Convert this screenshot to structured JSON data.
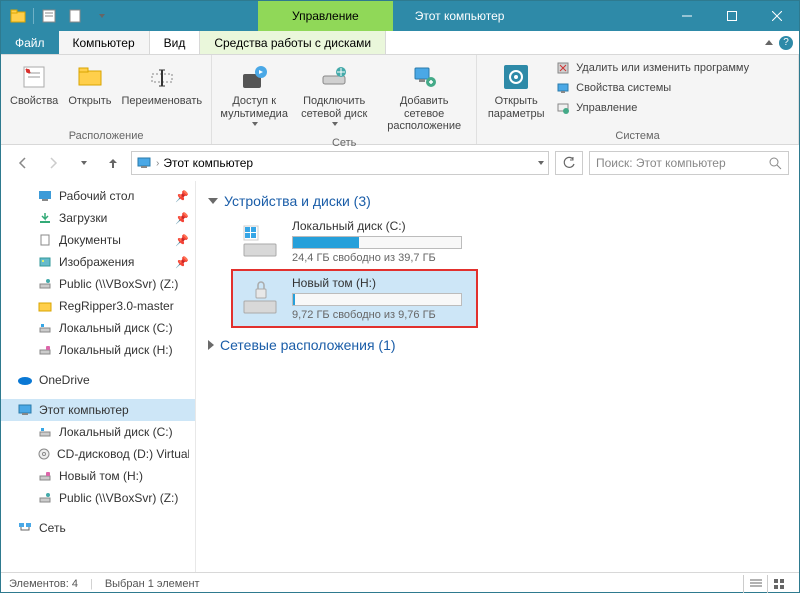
{
  "titlebar": {
    "context_label": "Управление",
    "window_title": "Этот компьютер"
  },
  "tabs": {
    "file": "Файл",
    "computer": "Компьютер",
    "view": "Вид",
    "disk_tools": "Средства работы с дисками"
  },
  "ribbon": {
    "group_location": "Расположение",
    "group_network": "Сеть",
    "group_system": "Система",
    "props": "Свойства",
    "open": "Открыть",
    "rename": "Переименовать",
    "media_access": "Доступ к мультимедиа",
    "map_drive": "Подключить сетевой диск",
    "add_net_loc": "Добавить сетевое расположение",
    "open_params": "Открыть параметры",
    "uninstall": "Удалить или изменить программу",
    "sys_props": "Свойства системы",
    "manage": "Управление"
  },
  "addressbar": {
    "crumb": "Этот компьютер",
    "search_placeholder": "Поиск: Этот компьютер"
  },
  "navpane": {
    "desktop": "Рабочий стол",
    "downloads": "Загрузки",
    "documents": "Документы",
    "pictures": "Изображения",
    "public": "Public (\\\\VBoxSvr) (Z:)",
    "regripper": "RegRipper3.0-master",
    "local_c": "Локальный диск (C:)",
    "local_h": "Локальный диск (H:)",
    "onedrive": "OneDrive",
    "this_pc": "Этот компьютер",
    "sub_local_c": "Локальный диск (C:)",
    "sub_cd": "CD-дисковод (D:) VirtualBox Guest Additions",
    "sub_newvol": "Новый том (H:)",
    "sub_public": "Public (\\\\VBoxSvr) (Z:)",
    "network": "Сеть"
  },
  "content": {
    "section_devices": "Устройства и диски (3)",
    "section_netloc": "Сетевые расположения (1)",
    "drive_c": {
      "name": "Локальный диск (C:)",
      "free": "24,4 ГБ свободно из 39,7 ГБ",
      "fill_pct": 39
    },
    "drive_h": {
      "name": "Новый том (H:)",
      "free": "9,72 ГБ свободно из 9,76 ГБ",
      "fill_pct": 1
    }
  },
  "statusbar": {
    "elements": "Элементов: 4",
    "selected": "Выбран 1 элемент"
  }
}
